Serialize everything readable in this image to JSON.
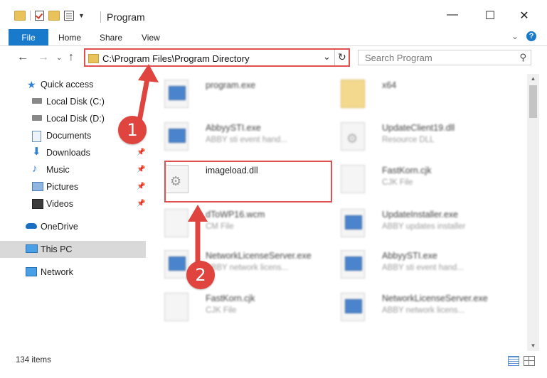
{
  "window": {
    "title": "Program"
  },
  "ribbon": {
    "file_label": "File",
    "tabs": [
      "Home",
      "Share",
      "View"
    ],
    "help": "?"
  },
  "nav": {
    "address": "C:\\Program Files\\Program Directory",
    "search_placeholder": "Search Program"
  },
  "sidebar": {
    "items": [
      {
        "label": "Quick access",
        "icon": "star-icon"
      },
      {
        "label": "Local Disk (C:)",
        "icon": "drive-icon"
      },
      {
        "label": "Local Disk (D:)",
        "icon": "drive-icon"
      },
      {
        "label": "Documents",
        "icon": "documents-icon"
      },
      {
        "label": "Downloads",
        "icon": "downloads-icon"
      },
      {
        "label": "Music",
        "icon": "music-icon"
      },
      {
        "label": "Pictures",
        "icon": "pictures-icon"
      },
      {
        "label": "Videos",
        "icon": "videos-icon"
      },
      {
        "label": "OneDrive",
        "icon": "cloud-icon"
      },
      {
        "label": "This PC",
        "icon": "computer-icon"
      },
      {
        "label": "Network",
        "icon": "network-icon"
      }
    ]
  },
  "files": [
    {
      "name": "program.exe",
      "desc": ""
    },
    {
      "name": "x64",
      "desc": ""
    },
    {
      "name": "AbbyySTI.exe",
      "desc": "ABBY sti event hand..."
    },
    {
      "name": "UpdateClient19.dll",
      "desc": "Resource DLL"
    },
    {
      "name": "imageload.dll",
      "desc": ""
    },
    {
      "name": "FastKorn.cjk",
      "desc": "CJK File"
    },
    {
      "name": "dToWP16.wcm",
      "desc": "CM File"
    },
    {
      "name": "UpdateInstaller.exe",
      "desc": "ABBY updates installer"
    },
    {
      "name": "NetworkLicenseServer.exe",
      "desc": "ABBY network licens..."
    },
    {
      "name": "AbbyySTI.exe",
      "desc": "ABBY sti event hand..."
    },
    {
      "name": "FastKorn.cjk",
      "desc": "CJK File"
    },
    {
      "name": "NetworkLicenseServer.exe",
      "desc": "ABBY network licens..."
    }
  ],
  "status": {
    "item_count": "134 items"
  },
  "annotations": {
    "step1": "1",
    "step2": "2",
    "color": "#e0443f"
  }
}
